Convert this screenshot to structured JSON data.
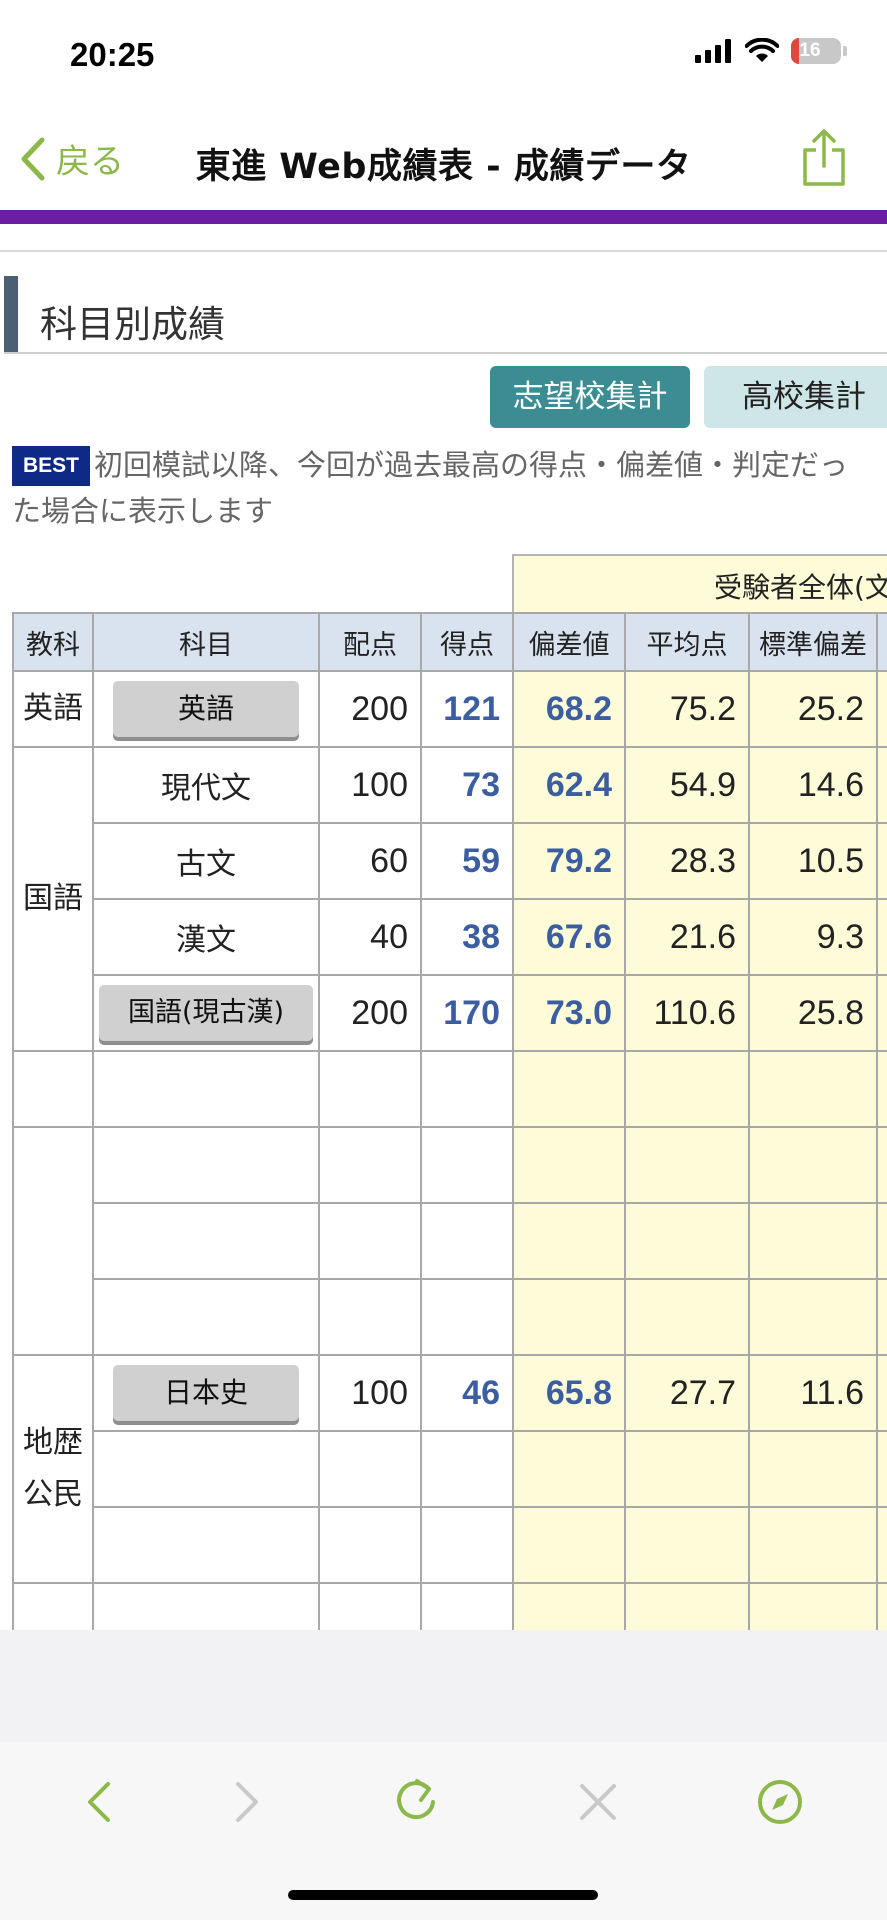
{
  "status": {
    "time": "20:25",
    "battery": "16",
    "battery_level": 0.16
  },
  "nav": {
    "back_label": "戻る",
    "title": "東進 Web成績表 - 成績データ"
  },
  "section": {
    "title": "科目別成績"
  },
  "buttons": {
    "primary": "志望校集計",
    "secondary": "高校集計"
  },
  "note": {
    "badge": "BEST",
    "text": "初回模試以降、今回が過去最高の得点・偏差値・判定だった場合に表示します"
  },
  "table": {
    "group_header": "受験者全体(文",
    "headers": [
      "教科",
      "科目",
      "配点",
      "得点",
      "偏差値",
      "平均点",
      "標準偏差"
    ],
    "categories": {
      "english": "英語",
      "japanese": "国語",
      "social": "地歴公民"
    },
    "rows": [
      {
        "subject": "英語",
        "full": "200",
        "score": "121",
        "dev": "68.2",
        "avg": "75.2",
        "sd": "25.2"
      },
      {
        "subject": "現代文",
        "full": "100",
        "score": "73",
        "dev": "62.4",
        "avg": "54.9",
        "sd": "14.6"
      },
      {
        "subject": "古文",
        "full": "60",
        "score": "59",
        "dev": "79.2",
        "avg": "28.3",
        "sd": "10.5"
      },
      {
        "subject": "漢文",
        "full": "40",
        "score": "38",
        "dev": "67.6",
        "avg": "21.6",
        "sd": "9.3"
      },
      {
        "subject": "国語(現古漢)",
        "full": "200",
        "score": "170",
        "dev": "73.0",
        "avg": "110.6",
        "sd": "25.8"
      },
      {
        "subject": "日本史",
        "full": "100",
        "score": "46",
        "dev": "65.8",
        "avg": "27.7",
        "sd": "11.6"
      }
    ]
  },
  "colors": {
    "accent": "#8cb84a",
    "purple": "#6a1fa3",
    "teal": "#3c8d93",
    "score_blue": "#3b5ea0",
    "highlight": "#fdfbd8",
    "header_bg": "#d9e3ef"
  }
}
